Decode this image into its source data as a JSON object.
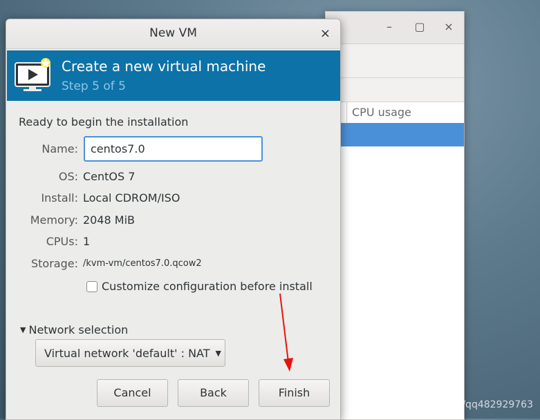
{
  "background_window": {
    "minimize_icon": "–",
    "maximize_icon": "▢",
    "close_icon": "×",
    "column_header": "CPU usage",
    "selected_color": "#4a90d9"
  },
  "dialog": {
    "title": "New VM",
    "close_icon": "×",
    "banner": {
      "title": "Create a new virtual machine",
      "step": "Step 5 of 5",
      "icon": "monitor-play-icon",
      "color": "#0d72a8"
    },
    "ready_text": "Ready to begin the installation",
    "fields": {
      "name_label": "Name:",
      "name_value": "centos7.0",
      "os_label": "OS:",
      "os_value": "CentOS 7",
      "install_label": "Install:",
      "install_value": "Local CDROM/ISO",
      "memory_label": "Memory:",
      "memory_value": "2048 MiB",
      "cpus_label": "CPUs:",
      "cpus_value": "1",
      "storage_label": "Storage:",
      "storage_value": "/kvm-vm/centos7.0.qcow2"
    },
    "customize_checkbox": {
      "label": "Customize configuration before install",
      "checked": false
    },
    "network": {
      "expander_label": "Network selection",
      "selected": "Virtual network 'default' : NAT"
    },
    "buttons": {
      "cancel": "Cancel",
      "back": "Back",
      "finish": "Finish"
    }
  },
  "annotation": {
    "arrow_color": "#e8120c"
  },
  "watermark": "https://blog.csdn.net/qq482929763"
}
